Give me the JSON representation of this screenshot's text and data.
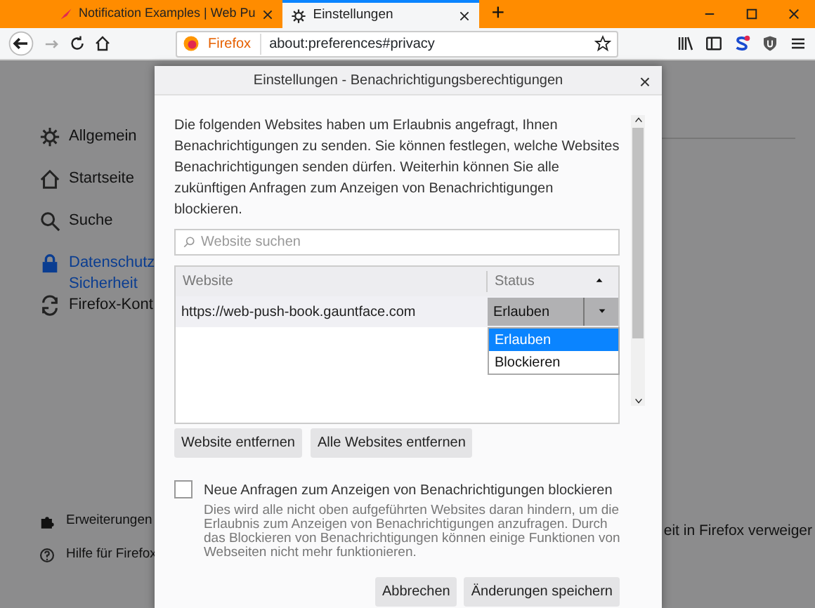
{
  "tabs": [
    {
      "label": "Notification Examples | Web Pu",
      "selected": false
    },
    {
      "label": "Einstellungen",
      "selected": true
    }
  ],
  "new_tab": "+",
  "address_bar": {
    "identity": "Firefox",
    "url": "about:preferences#privacy"
  },
  "sidebar": {
    "items": [
      {
        "kind": "gear",
        "label": "Allgemein",
        "selected": false
      },
      {
        "kind": "home",
        "label": "Startseite",
        "selected": false
      },
      {
        "kind": "search",
        "label": "Suche",
        "selected": false
      },
      {
        "kind": "lock",
        "label": "Datenschutz\nSicherheit",
        "selected": true
      },
      {
        "kind": "sync",
        "label": "Firefox-Kont",
        "selected": false
      }
    ],
    "footer": [
      {
        "kind": "puzzle",
        "label": "Erweiterungen"
      },
      {
        "kind": "help",
        "label": "Hilfe für Firefox"
      }
    ]
  },
  "background_text": "eit in Firefox verweiger",
  "dialog": {
    "title": "Einstellungen - Benachrichtigungsberechtigungen",
    "close": "×",
    "description": "Die folgenden Websites haben um Erlaubnis angefragt, Ihnen Benachrichtigungen zu senden. Sie können festlegen, welche Websites Benachrichtigungen senden dürfen. Weiterhin können Sie alle zukünftigen Anfragen zum Anzeigen von Benachrichtigungen blockieren.",
    "search": {
      "placeholder": "Website suchen"
    },
    "table": {
      "columns": [
        "Website",
        "Status"
      ],
      "rows": [
        {
          "website": "https://web-push-book.gauntface.com",
          "status": "Erlauben",
          "selected": true
        }
      ]
    },
    "status_menu": [
      {
        "label": "Erlauben",
        "selected": true
      },
      {
        "label": "Blockieren",
        "selected": false
      }
    ],
    "row_buttons": [
      "Website entfernen",
      "Alle Websites entfernen"
    ],
    "block_new": {
      "label": "Neue Anfragen zum Anzeigen von Benachrichtigungen blockieren",
      "checked": false,
      "hint": "Dies wird alle nicht oben aufgeführten Websites daran hindern, um die Erlaubnis zum Anzeigen von Benachrichtigungen anzufragen. Durch das Blockieren von Benachrichtigungen können einige Funktionen von Webseiten nicht mehr funktionieren."
    },
    "footer_buttons": [
      "Abbrechen",
      "Änderungen speichern"
    ]
  }
}
